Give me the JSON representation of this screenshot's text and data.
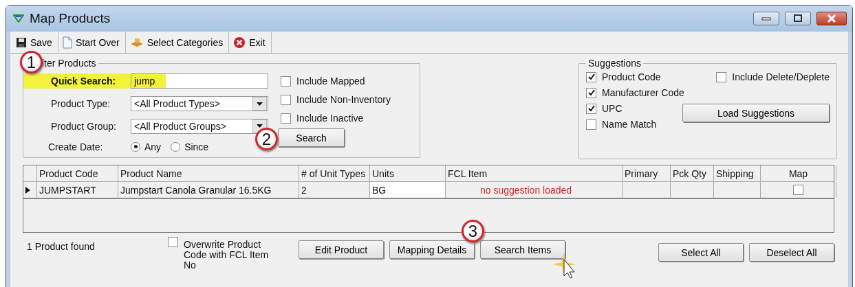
{
  "window": {
    "title": "Map Products"
  },
  "toolbar": [
    {
      "kind": "save",
      "label": "Save"
    },
    {
      "kind": "page",
      "label": "Start Over"
    },
    {
      "kind": "categories",
      "label": "Select Categories"
    },
    {
      "kind": "exit",
      "label": "Exit"
    }
  ],
  "filter": {
    "legend": "lter Products",
    "quick_search": {
      "label": "Quick Search:",
      "value": "jump"
    },
    "product_type": {
      "label": "Product Type:",
      "value": "<All Product Types>"
    },
    "product_group": {
      "label": "Product Group:",
      "value": "<All Product Groups>"
    },
    "create_date": {
      "label": "Create Date:",
      "options": [
        {
          "label": "Any",
          "selected": true
        },
        {
          "label": "Since",
          "selected": false
        }
      ]
    },
    "options": [
      {
        "label": "Include Mapped",
        "checked": false
      },
      {
        "label": "Include Non-Inventory",
        "checked": false
      },
      {
        "label": "Include Inactive",
        "checked": false
      }
    ],
    "search_button": "Search"
  },
  "suggestions": {
    "legend": "Suggestions",
    "options": [
      {
        "label": "Product Code",
        "checked": true
      },
      {
        "label": "Manufacturer Code",
        "checked": true
      },
      {
        "label": "UPC",
        "checked": true
      },
      {
        "label": "Name Match",
        "checked": false
      }
    ],
    "include_delete": {
      "label": "Include Delete/Deplete",
      "checked": false
    },
    "load_button": "Load Suggestions"
  },
  "grid": {
    "columns": [
      "Product Code",
      "Product Name",
      "# of Unit Types",
      "Units",
      "FCL Item",
      "Primary",
      "Pck Qty",
      "Shipping",
      "Map"
    ],
    "rows": [
      {
        "current": true,
        "product_code": "JUMPSTART",
        "product_name": "Jumpstart Canola Granular 16.5KG",
        "unit_types": "2",
        "units": "BG",
        "fcl_item": "no suggestion loaded",
        "map": false
      }
    ]
  },
  "status": "1 Product found",
  "overwrite": {
    "label": "Overwrite Product Code with FCL Item No",
    "checked": false
  },
  "buttons": [
    "Edit Product",
    "Mapping Details",
    "Search Items"
  ],
  "select_buttons": [
    "Select All",
    "Deselect All"
  ],
  "callouts": [
    "1",
    "2",
    "3"
  ]
}
